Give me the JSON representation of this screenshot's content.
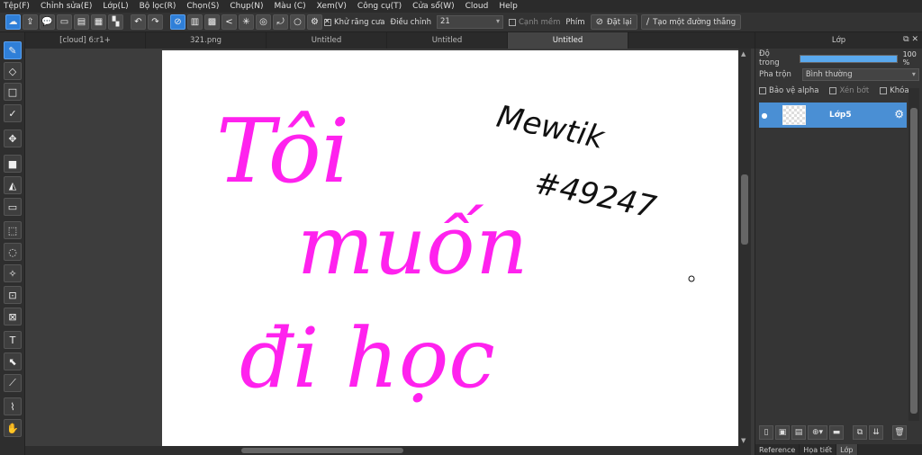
{
  "menu": [
    "Tệp(F)",
    "Chỉnh sửa(E)",
    "Lớp(L)",
    "Bộ lọc(R)",
    "Chọn(S)",
    "Chụp(N)",
    "Màu (C)",
    "Xem(V)",
    "Công cụ(T)",
    "Cửa sổ(W)",
    "Cloud",
    "Help"
  ],
  "toolbar": {
    "antialias_label": "Khử răng cưa",
    "adjust_label": "Điều chỉnh",
    "adjust_value": "21",
    "sharp_edge_label": "Cạnh mềm",
    "key_label": "Phím",
    "reset_label": "Đặt lại",
    "line_label": "Tạo một đường thẳng"
  },
  "tabs": [
    "[cloud] 6:r1+",
    "321.png",
    "Untitled",
    "Untitled",
    "Untitled"
  ],
  "canvas": {
    "text_pink_1": "Tôi",
    "text_pink_2": "muốn",
    "text_pink_3": "đi học",
    "text_black_1": "Mewtik",
    "text_black_2": "#49247"
  },
  "panel": {
    "title": "Lớp",
    "opacity_label": "Độ trong",
    "opacity_value": "100 %",
    "opacity_fraction": 1.0,
    "blend_label": "Pha trộn",
    "blend_value": "Bình thường",
    "protect_alpha": "Bảo vệ alpha",
    "clip": "Xén bớt",
    "lock": "Khóa",
    "layer_name": "Lớp5",
    "bottom_tabs": [
      "Reference",
      "Họa tiết",
      "Lớp"
    ]
  },
  "colors": {
    "accent": "#2f7fd8",
    "ink_pink": "#ff22ee",
    "ink_black": "#111111"
  }
}
